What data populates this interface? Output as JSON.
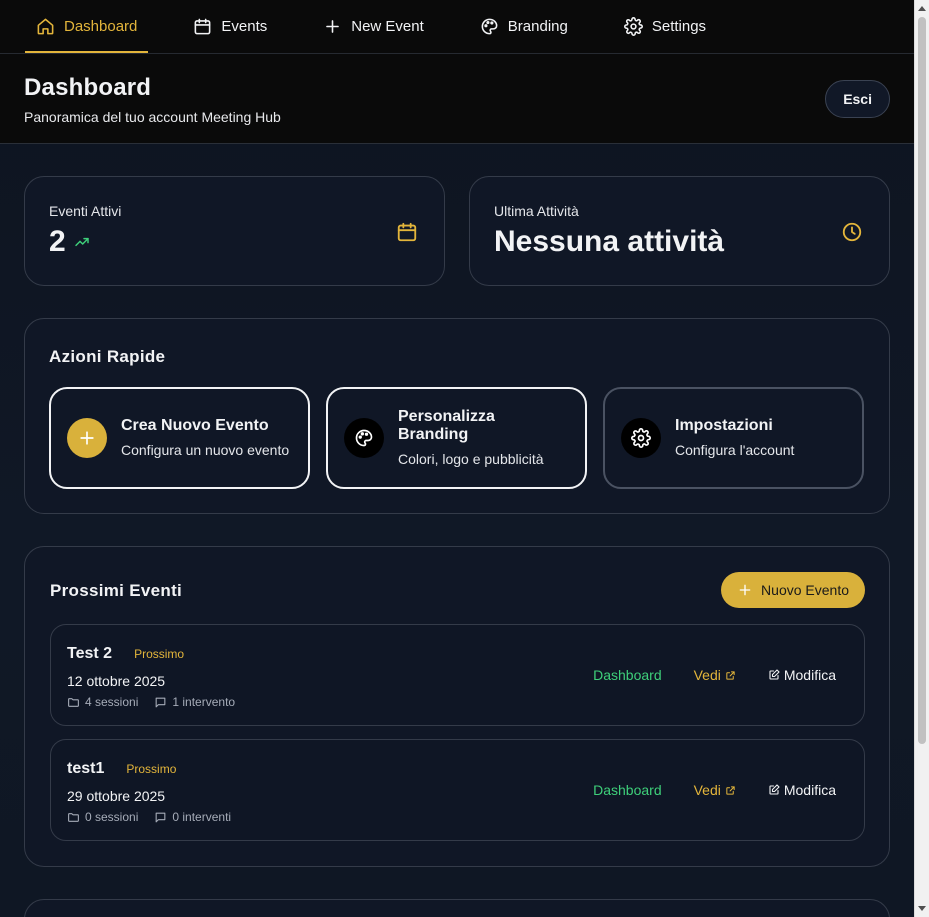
{
  "nav": {
    "items": [
      {
        "label": "Dashboard",
        "icon": "home-icon",
        "active": true
      },
      {
        "label": "Events",
        "icon": "calendar-icon"
      },
      {
        "label": "New Event",
        "icon": "plus-icon"
      },
      {
        "label": "Branding",
        "icon": "palette-icon"
      },
      {
        "label": "Settings",
        "icon": "gear-icon"
      }
    ]
  },
  "header": {
    "title": "Dashboard",
    "subtitle": "Panoramica del tuo account Meeting Hub",
    "logout_label": "Esci"
  },
  "stats": {
    "active_events": {
      "label": "Eventi Attivi",
      "value": "2",
      "icon": "calendar-icon"
    },
    "last_activity": {
      "label": "Ultima Attività",
      "value": "Nessuna attività",
      "icon": "clock-icon"
    }
  },
  "quick_actions": {
    "title": "Azioni Rapide",
    "items": [
      {
        "title": "Crea Nuovo Evento",
        "desc": "Configura un nuovo evento",
        "icon": "plus-icon"
      },
      {
        "title": "Personalizza Branding",
        "desc": "Colori, logo e pubblicità",
        "icon": "palette-icon"
      },
      {
        "title": "Impostazioni",
        "desc": "Configura l'account",
        "icon": "gear-icon"
      }
    ]
  },
  "upcoming": {
    "title": "Prossimi Eventi",
    "new_button": "Nuovo Evento",
    "events": [
      {
        "name": "Test 2",
        "status": "Prossimo",
        "date": "12 ottobre 2025",
        "sessions": "4 sessioni",
        "talks": "1 intervento",
        "actions": {
          "dashboard": "Dashboard",
          "view": "Vedi",
          "edit": "Modifica"
        }
      },
      {
        "name": "test1",
        "status": "Prossimo",
        "date": "29 ottobre 2025",
        "sessions": "0 sessioni",
        "talks": "0 interventi",
        "actions": {
          "dashboard": "Dashboard",
          "view": "Vedi",
          "edit": "Modifica"
        }
      }
    ]
  },
  "colors": {
    "accent": "#e3b53b",
    "success": "#3ecf7a",
    "background": "#0e1420",
    "card": "#111827"
  }
}
